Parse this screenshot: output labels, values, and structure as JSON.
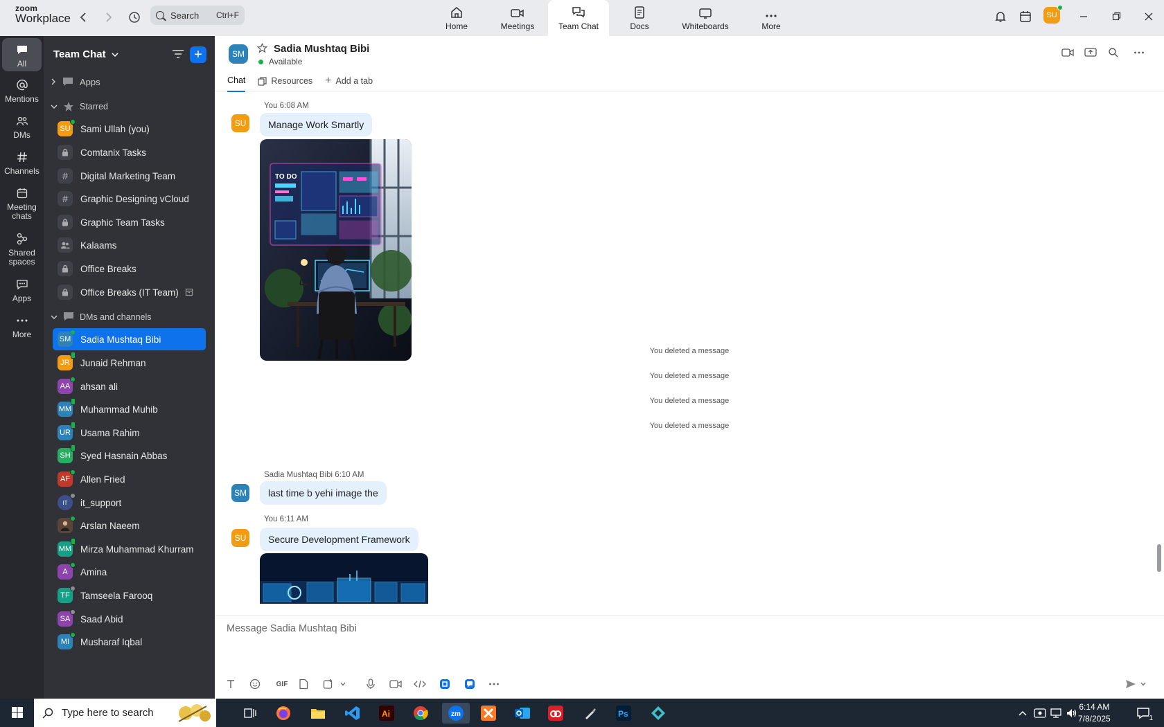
{
  "app": {
    "brand_top": "zoom",
    "brand_bottom": "Workplace"
  },
  "search": {
    "label": "Search",
    "shortcut": "Ctrl+F"
  },
  "topnav": [
    {
      "label": "Home",
      "icon": "home-icon"
    },
    {
      "label": "Meetings",
      "icon": "video-camera-icon"
    },
    {
      "label": "Team Chat",
      "icon": "chat-bubbles-icon",
      "active": true
    },
    {
      "label": "Docs",
      "icon": "document-icon"
    },
    {
      "label": "Whiteboards",
      "icon": "whiteboard-icon"
    },
    {
      "label": "More",
      "icon": "more-dots-icon"
    }
  ],
  "user": {
    "initials": "SU",
    "color": "#f39c12"
  },
  "rail": [
    {
      "label": "All",
      "icon": "chat-icon",
      "active": true
    },
    {
      "label": "Mentions",
      "icon": "at-sign-icon"
    },
    {
      "label": "DMs",
      "icon": "people-icon"
    },
    {
      "label": "Channels",
      "icon": "hashtag-icon"
    },
    {
      "label": "Meeting chats",
      "icon": "calendar-icon"
    },
    {
      "label": "Shared spaces",
      "icon": "shared-spaces-icon"
    },
    {
      "label": "Apps",
      "icon": "apps-icon"
    },
    {
      "label": "More",
      "icon": "more-dots-icon"
    }
  ],
  "sidebar": {
    "title": "Team Chat",
    "apps_label": "Apps",
    "starred_label": "Starred",
    "starred": [
      {
        "name": "Sami Ullah (you)",
        "kind": "avatar",
        "initials": "SU",
        "color": "#f39c12",
        "status": "online"
      },
      {
        "name": "Comtanix Tasks",
        "kind": "lock"
      },
      {
        "name": "Digital Marketing Team",
        "kind": "hash"
      },
      {
        "name": "Graphic Designing vCloud",
        "kind": "hash"
      },
      {
        "name": "Graphic Team Tasks",
        "kind": "lock"
      },
      {
        "name": "Kalaams",
        "kind": "group"
      },
      {
        "name": "Office Breaks",
        "kind": "lock"
      },
      {
        "name": "Office Breaks (IT Team)",
        "kind": "lock"
      }
    ],
    "dms_label": "DMs and channels",
    "dms": [
      {
        "name": "Sadia Mushtaq Bibi",
        "initials": "SM",
        "color": "#2d82b7",
        "status": "online",
        "selected": true
      },
      {
        "name": "Junaid Rehman",
        "initials": "JR",
        "color": "#f39c12",
        "status": "phone"
      },
      {
        "name": "ahsan ali",
        "initials": "AA",
        "color": "#8e44ad",
        "status": "online"
      },
      {
        "name": "Muhammad Muhib",
        "initials": "MM",
        "color": "#2d82b7",
        "status": "phone"
      },
      {
        "name": "Usama Rahim",
        "initials": "UR",
        "color": "#2d82b7",
        "status": "phone"
      },
      {
        "name": "Syed Hasnain Abbas",
        "initials": "SH",
        "color": "#27ae60",
        "status": "phone"
      },
      {
        "name": "Allen Fried",
        "initials": "AF",
        "color": "#c0392b",
        "status": "online"
      },
      {
        "name": "it_support",
        "initials": "IT",
        "color": "#3b4f8a",
        "status": "offline"
      },
      {
        "name": "Arslan Naeem",
        "initials": "AN",
        "color": "#5a4636",
        "status": "online"
      },
      {
        "name": "Mirza Muhammad Khurram",
        "initials": "MM",
        "color": "#16a085",
        "status": "phone"
      },
      {
        "name": "Amina",
        "initials": "A",
        "color": "#8e44ad",
        "status": "online"
      },
      {
        "name": "Tamseela Farooq",
        "initials": "TF",
        "color": "#16a085",
        "status": "offline"
      },
      {
        "name": "Saad Abid",
        "initials": "SA",
        "color": "#8e44ad",
        "status": "offline"
      },
      {
        "name": "Musharaf Iqbal",
        "initials": "MI",
        "color": "#2d82b7",
        "status": "online"
      }
    ]
  },
  "chat": {
    "contact_initials": "SM",
    "contact_name": "Sadia Mushtaq Bibi",
    "contact_status": "Available",
    "tabs": [
      "Chat",
      "Resources",
      "Add a tab"
    ],
    "messages": [
      {
        "sender": "You",
        "time": "6:08 AM",
        "initials": "SU",
        "color": "#f39c12",
        "text": "Manage Work Smartly"
      },
      {
        "system": "You deleted a message"
      },
      {
        "system": "You deleted a message"
      },
      {
        "system": "You deleted a message"
      },
      {
        "system": "You deleted a message"
      },
      {
        "sender": "Sadia Mushtaq Bibi",
        "time": "6:10 AM",
        "initials": "SM",
        "color": "#2d82b7",
        "text": "last time b yehi image the"
      },
      {
        "sender": "You",
        "time": "6:11 AM",
        "initials": "SU",
        "color": "#f39c12",
        "text": "Secure Development Framework"
      }
    ],
    "composer_placeholder": "Message Sadia Mushtaq Bibi",
    "composer_gif": "GIF"
  },
  "taskbar": {
    "search_placeholder": "Type here to search",
    "time": "6:14 AM",
    "date": "7/8/2025",
    "notification_count": "1"
  }
}
